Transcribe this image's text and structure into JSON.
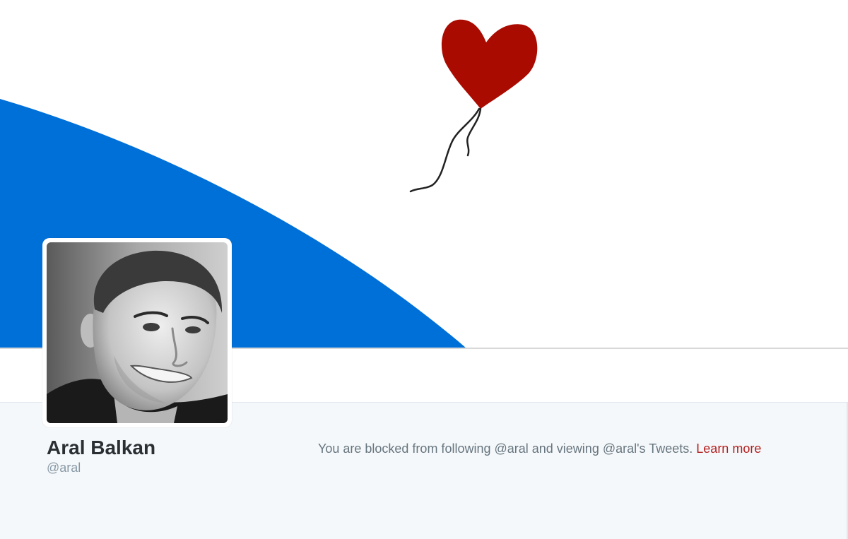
{
  "profile": {
    "name": "Aral Balkan",
    "handle": "@aral"
  },
  "blocked_notice": {
    "message": "You are blocked from following @aral and viewing @aral's Tweets.",
    "learn_more_label": "Learn more"
  },
  "colors": {
    "banner_blue": "#0070d9",
    "balloon_red": "#aa0b00",
    "link_red": "#b31f1f",
    "page_background": "#f5f8fa"
  },
  "icons": {
    "banner_art": "heart-balloon-icon"
  }
}
